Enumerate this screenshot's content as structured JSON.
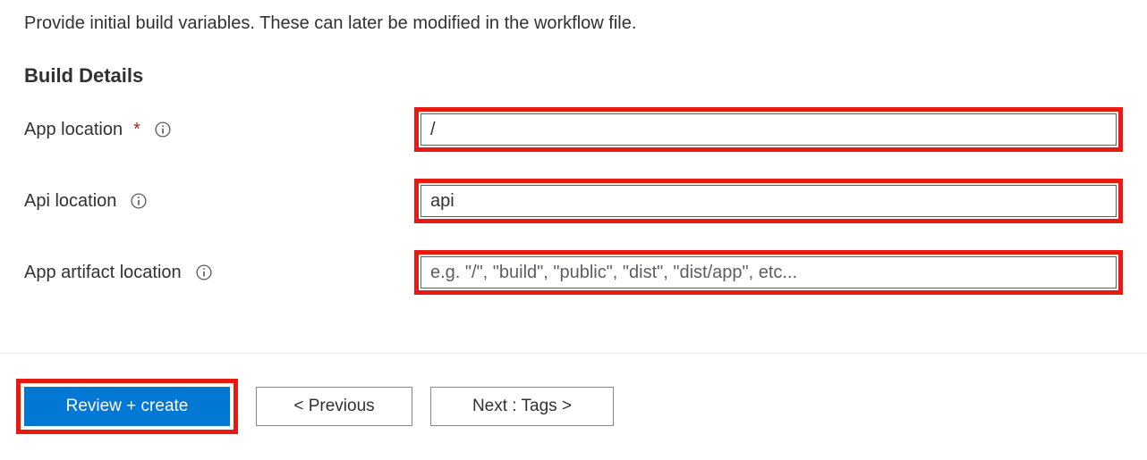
{
  "description": "Provide initial build variables. These can later be modified in the workflow file.",
  "section_title": "Build Details",
  "fields": {
    "app_location": {
      "label": "App location",
      "required": true,
      "value": "/",
      "placeholder": ""
    },
    "api_location": {
      "label": "Api location",
      "required": false,
      "value": "api",
      "placeholder": ""
    },
    "app_artifact_location": {
      "label": "App artifact location",
      "required": false,
      "value": "",
      "placeholder": "e.g. \"/\", \"build\", \"public\", \"dist\", \"dist/app\", etc..."
    }
  },
  "footer": {
    "review_create": "Review + create",
    "previous": "< Previous",
    "next": "Next : Tags >"
  },
  "colors": {
    "highlight": "#e8190e",
    "primary": "#0078d4"
  }
}
